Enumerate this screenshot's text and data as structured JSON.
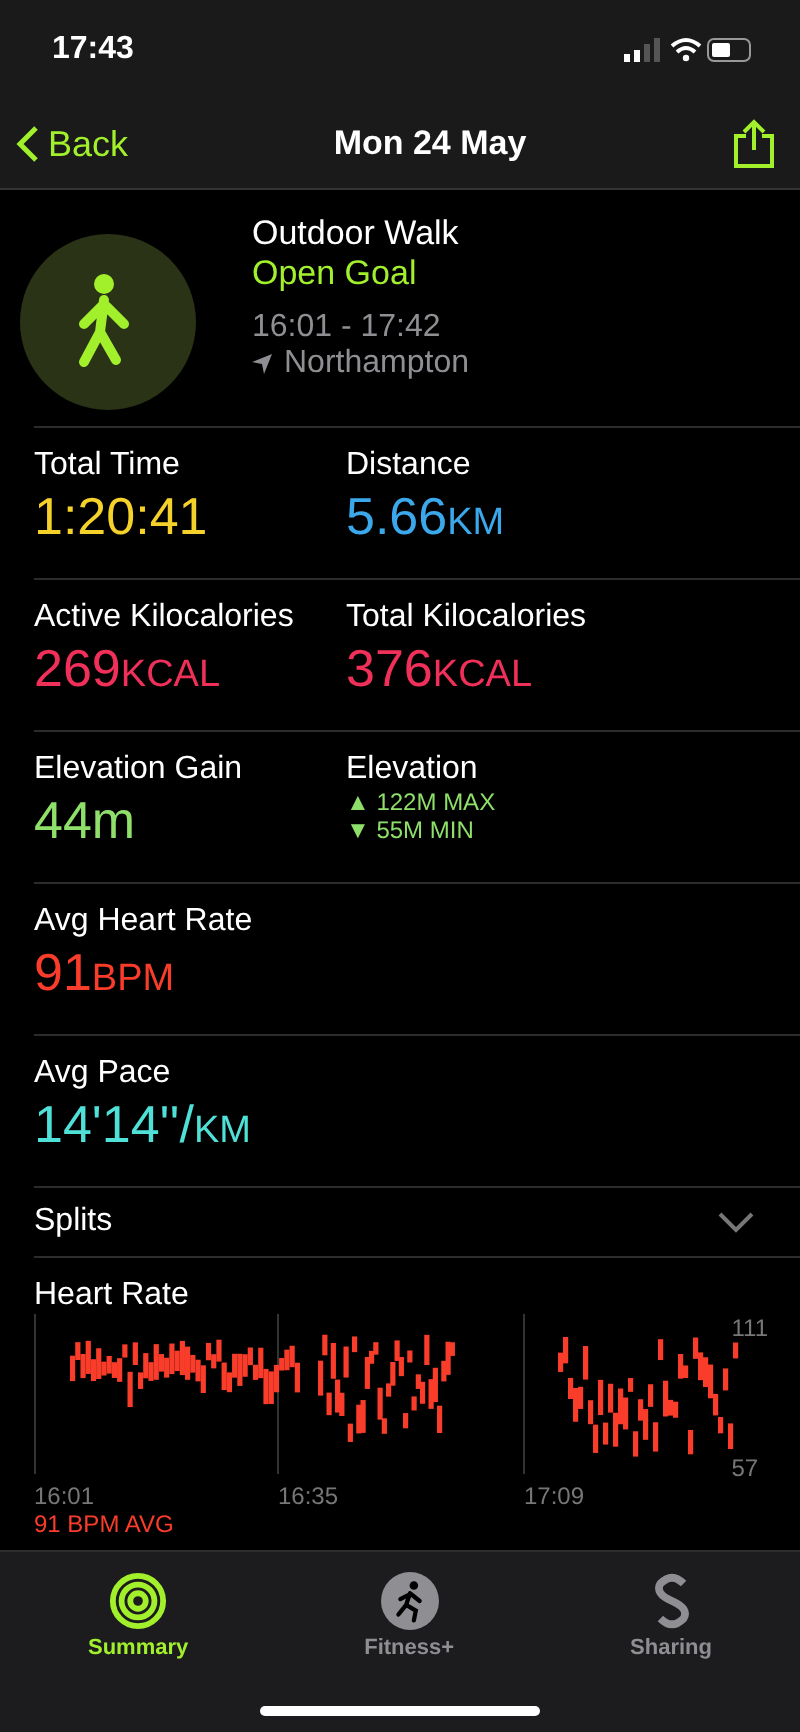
{
  "status_bar": {
    "time": "17:43"
  },
  "nav": {
    "back": "Back",
    "title": "Mon 24 May"
  },
  "workout": {
    "name": "Outdoor Walk",
    "goal": "Open Goal",
    "time_range": "16:01 - 17:42",
    "location": "Northampton"
  },
  "metric_rows": [
    [
      {
        "label": "Total Time",
        "value": "1:20:41",
        "color": "#f5d22a"
      },
      {
        "label": "Distance",
        "value": "5.66",
        "unit": "KM",
        "color": "#3aa8ea"
      }
    ],
    [
      {
        "label": "Active Kilocalories",
        "value": "269",
        "unit": "KCAL",
        "color": "#f1305a"
      },
      {
        "label": "Total Kilocalories",
        "value": "376",
        "unit": "KCAL",
        "color": "#f1305a"
      }
    ],
    [
      {
        "label": "Elevation Gain",
        "value": "44m",
        "color": "#8ee06a"
      },
      {
        "label": "Elevation",
        "lines": [
          "▲ 122M MAX",
          "▼ 55M MIN"
        ],
        "color": "#8ee06a"
      }
    ],
    [
      {
        "label": "Avg Heart Rate",
        "value": "91",
        "unit": "BPM",
        "color": "#fa3c2a"
      }
    ],
    [
      {
        "label": "Avg Pace",
        "value": "14'14''/",
        "unit": "KM",
        "color": "#4fe0d8"
      }
    ]
  ],
  "splits": {
    "label": "Splits",
    "expanded": false
  },
  "heart_rate": {
    "title": "Heart Rate",
    "max_label": "111",
    "min_label": "57",
    "time_labels": [
      "16:01",
      "16:35",
      "17:09"
    ],
    "average": "91 BPM AVG"
  },
  "tab_bar": [
    {
      "label": "Summary",
      "selected": true
    },
    {
      "label": "Fitness+",
      "selected": false
    },
    {
      "label": "Sharing",
      "selected": false
    }
  ]
}
